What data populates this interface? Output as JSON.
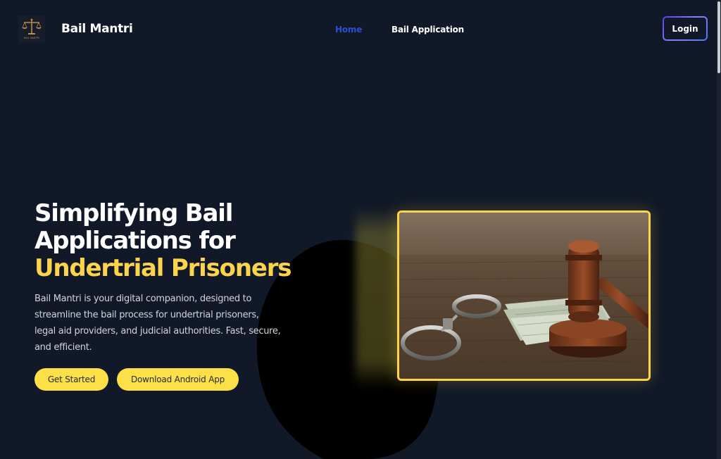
{
  "header": {
    "brand": "Bail Mantri",
    "logo_text": "BAIL MANTRI",
    "nav": [
      {
        "label": "Home",
        "active": true
      },
      {
        "label": "Bail Application",
        "active": false
      }
    ],
    "login_label": "Login"
  },
  "hero": {
    "title_line1": "Simplifying Bail",
    "title_line2": "Applications for",
    "title_accent": "Undertrial Prisoners",
    "description": "Bail Mantri is your digital companion, designed to streamline the bail process for undertrial prisoners, legal aid providers, and judicial authorities. Fast, secure, and efficient.",
    "buttons": {
      "get_started": "Get Started",
      "download_android": "Download Android App"
    }
  },
  "icons": {
    "logo": "scales-of-justice-icon",
    "hero_image": "gavel-handcuffs-money-photo"
  },
  "colors": {
    "background": "#111827",
    "accent_yellow": "#fcd34d",
    "button_yellow": "#fde047",
    "nav_active": "#2a50d0",
    "login_gradient_start": "#5b3df5",
    "login_gradient_end": "#3b82f6"
  }
}
